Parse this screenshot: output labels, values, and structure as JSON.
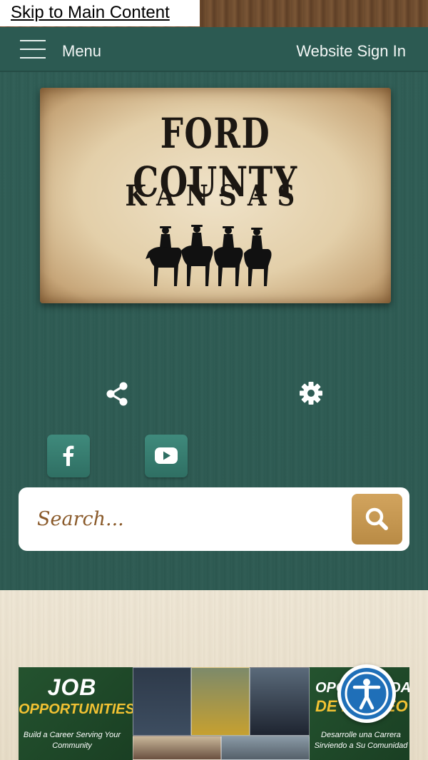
{
  "skip_link": {
    "label": "Skip to Main Content"
  },
  "navbar": {
    "menu_label": "Menu",
    "sign_in_label": "Website Sign In"
  },
  "logo": {
    "line1": "FORD COUNTY",
    "line2": "KANSAS"
  },
  "tools": {
    "share_icon": "share-icon",
    "settings_icon": "gear-icon"
  },
  "social": [
    {
      "name": "facebook",
      "icon": "facebook-icon"
    },
    {
      "name": "youtube",
      "icon": "youtube-icon"
    }
  ],
  "search": {
    "placeholder": "Search...",
    "button_icon": "search-icon"
  },
  "banner": {
    "left_title": "JOB",
    "left_subtitle": "OPPORTUNITIES",
    "left_tagline": "Build a Career Serving Your Community",
    "right_title": "OPORTUNIDADES",
    "right_subtitle": "DE EMPLEO",
    "right_tagline": "Desarrolle una Carrera Sirviendo a Su Comunidad"
  },
  "colors": {
    "nav": "#2c5a52",
    "hero": "#2f5b54",
    "search_button": "#c99a52",
    "accessibility": "#1f6fb8"
  }
}
